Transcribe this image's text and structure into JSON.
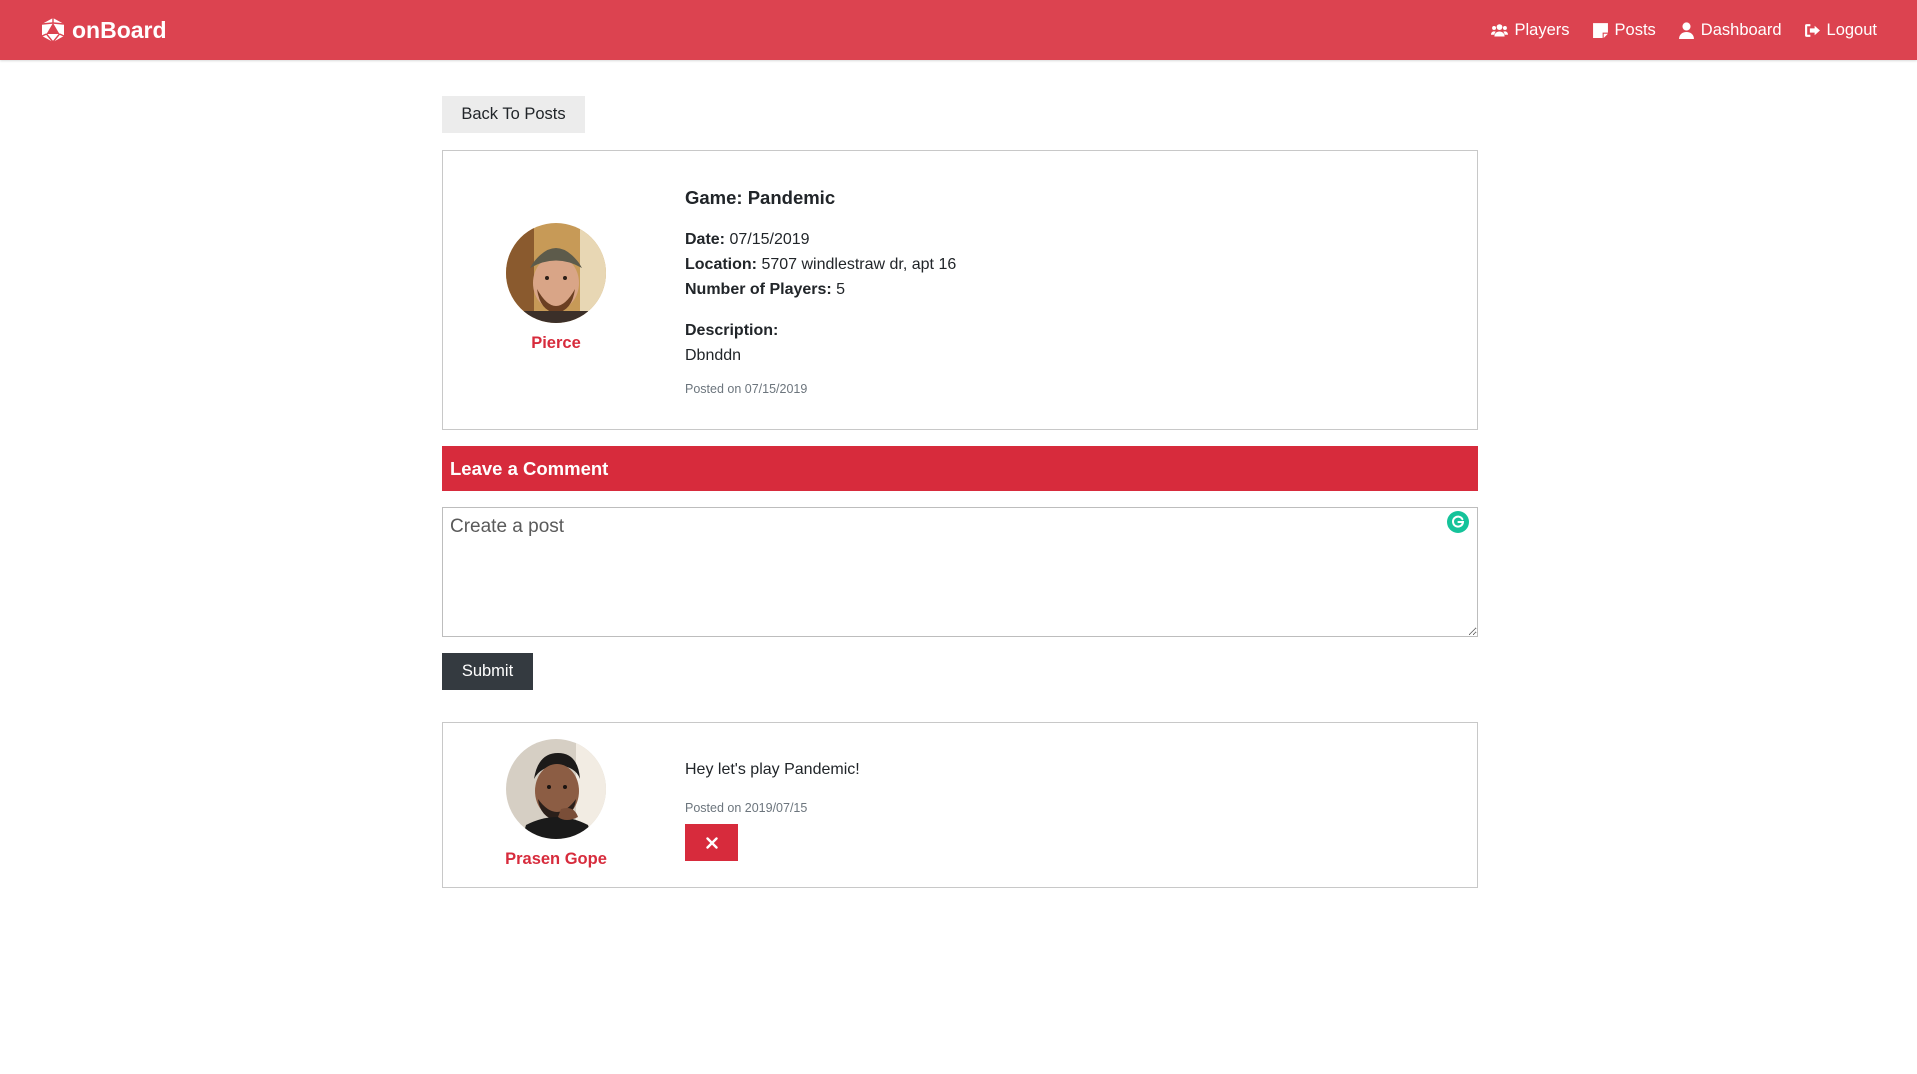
{
  "navbar": {
    "brand": "onBoard",
    "brand_icon": "d20-dice-icon",
    "bg_color": "#dc4350",
    "links": [
      {
        "label": "Players",
        "icon": "users-icon"
      },
      {
        "label": "Posts",
        "icon": "sticky-note-icon"
      },
      {
        "label": "Dashboard",
        "icon": "user-icon"
      },
      {
        "label": "Logout",
        "icon": "sign-out-icon"
      }
    ]
  },
  "back_button": "Back To Posts",
  "post": {
    "author": "Pierce",
    "game": "Game: Pandemic",
    "date_label": "Date:",
    "date": "07/15/2019",
    "location_label": "Location:",
    "location": "5707 windlestraw dr, apt 16",
    "players_label": "Number of Players:",
    "players": "5",
    "description_label": "Description:",
    "description": "Dbnddn",
    "posted_on": "Posted on 07/15/2019"
  },
  "comment_form": {
    "header": "Leave a Comment",
    "placeholder": "Create a post",
    "submit_label": "Submit",
    "accent_color": "#d72b3c"
  },
  "comments": [
    {
      "author": "Prasen Gope",
      "text": "Hey let's play Pandemic!",
      "posted_on": "Posted on 2019/07/15",
      "delete_icon": "times-icon"
    }
  ]
}
